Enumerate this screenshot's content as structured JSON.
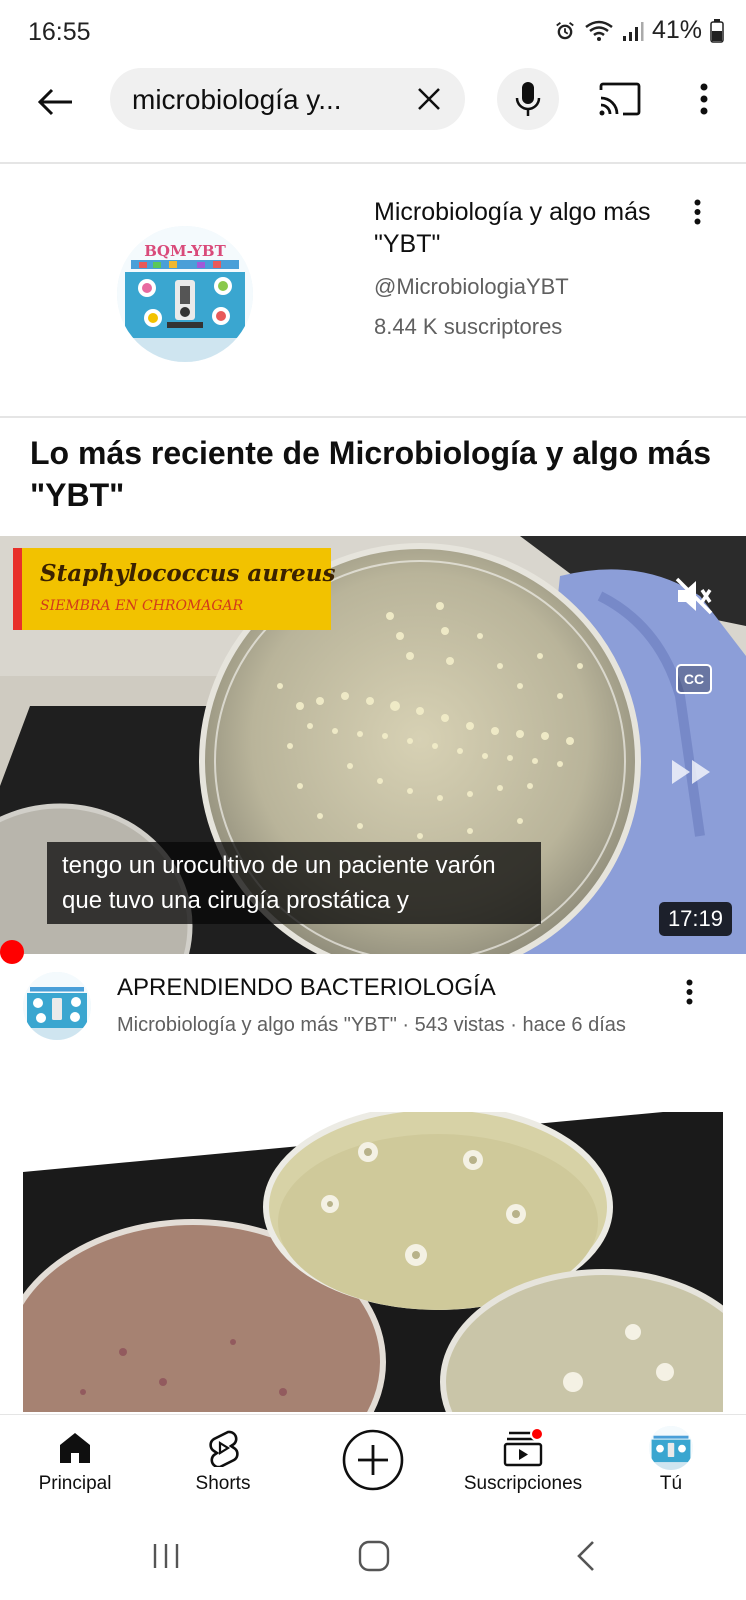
{
  "status_bar": {
    "time": "16:55",
    "battery": "41%",
    "icons": [
      "alarm-icon",
      "wifi-icon",
      "signal-icon",
      "battery-icon"
    ]
  },
  "search": {
    "query": "microbiología y...",
    "icons": [
      "back-arrow-icon",
      "clear-icon",
      "mic-icon",
      "cast-icon",
      "more-vert-icon"
    ]
  },
  "channel": {
    "name": "Microbiología y algo más \"YBT\"",
    "handle": "@MicrobiologiaYBT",
    "subscribers": "8.44 K suscriptores",
    "logo_text": "BQM-YBT"
  },
  "section": {
    "title": "Lo más reciente de Microbiología y algo más \"YBT\""
  },
  "player": {
    "title_card_main": "Staphylococcus aureus",
    "title_card_sub": "SIEMBRA EN CHROMAGAR",
    "cc_label": "CC",
    "caption_line1": "tengo un urocultivo de un paciente varón",
    "caption_line2": "que tuvo una cirugía prostática y",
    "duration": "17:19",
    "muted": true
  },
  "video": {
    "title": "APRENDIENDO BACTERIOLOGÍA",
    "meta": "Microbiología y algo más \"YBT\" · 543 vistas · hace 6 días"
  },
  "bottom_nav": {
    "items": [
      {
        "label": "Principal",
        "icon": "home-icon",
        "active": true
      },
      {
        "label": "Shorts",
        "icon": "shorts-icon"
      },
      {
        "label": "",
        "icon": "create-icon"
      },
      {
        "label": "Suscripciones",
        "icon": "subscriptions-icon",
        "notification": true
      },
      {
        "label": "Tú",
        "icon": "avatar"
      }
    ]
  },
  "colors": {
    "accent_red": "#ff0000",
    "secondary_text": "#606060",
    "search_bg": "#f0f0f0",
    "title_card_yellow": "#f2c200"
  }
}
